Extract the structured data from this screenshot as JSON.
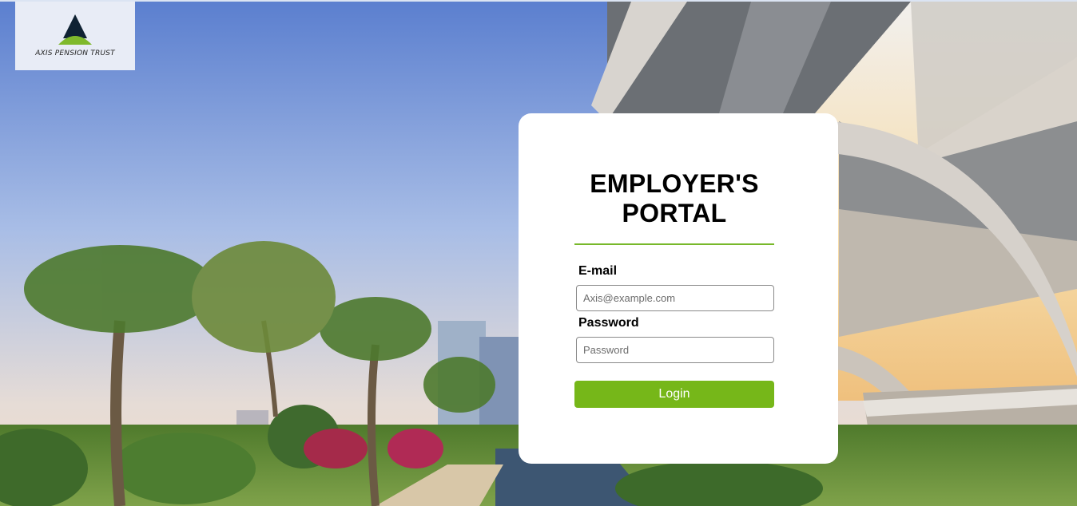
{
  "brand": {
    "name": "AXIS PENSION TRUST",
    "logo_icon": "triangle-mountain-logo-icon",
    "colors": {
      "dark": "#0f2233",
      "green": "#7fb92c"
    }
  },
  "login": {
    "title": "EMPLOYER'S PORTAL",
    "email_label": "E-mail",
    "email_placeholder": "Axis@example.com",
    "email_value": "",
    "password_label": "Password",
    "password_placeholder": "Password",
    "password_value": "",
    "button_label": "Login"
  },
  "theme": {
    "accent": "#76b719",
    "card_bg": "#ffffff"
  }
}
